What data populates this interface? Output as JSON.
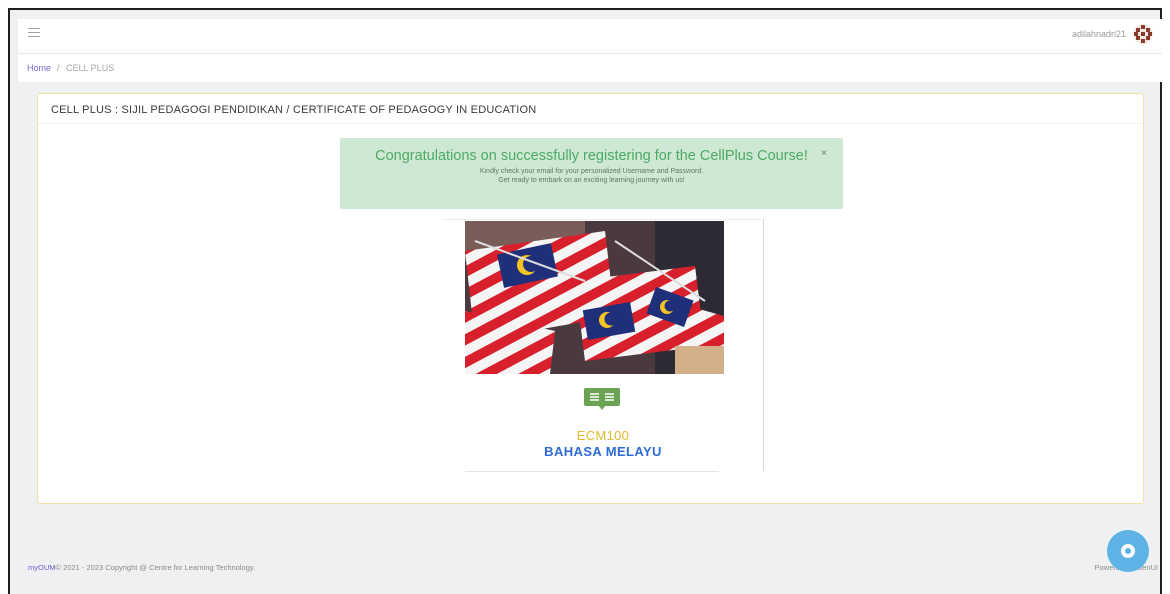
{
  "header": {
    "menu_icon": "hamburger-icon",
    "username": "adilahnadri21",
    "avatar_icon": "avatar-icon"
  },
  "breadcrumb": {
    "home": "Home",
    "separator": "/",
    "current": "CELL PLUS"
  },
  "card": {
    "title": "CELL PLUS : SIJIL PEDAGOGI PENDIDIKAN / CERTIFICATE OF PEDAGOGY IN EDUCATION"
  },
  "alert": {
    "title": "Congratulations on successfully registering for the CellPlus Course!",
    "line1": "Kindly check your email for your personalized Username and Password.",
    "line2": "Get ready to embark on an exciting learning journey with us!",
    "close": "×"
  },
  "course": {
    "image_icon": "malaysia-flags-image",
    "book_icon": "open-book-icon",
    "code": "ECM100",
    "name": "BAHASA MELAYU"
  },
  "footer": {
    "brand": "myOUM",
    "copyright": "© 2021 - 2023 Copyright @ Centre for Learning Technology.",
    "powered": "Powered by GenUI"
  },
  "chat": {
    "icon": "chat-icon"
  },
  "colors": {
    "accent": "#7b6ad0",
    "alert_bg": "#cfe8d3",
    "alert_text": "#4caa66",
    "course_code": "#e0b92e",
    "course_name": "#2f6bd6",
    "chat": "#5fb2e6"
  }
}
